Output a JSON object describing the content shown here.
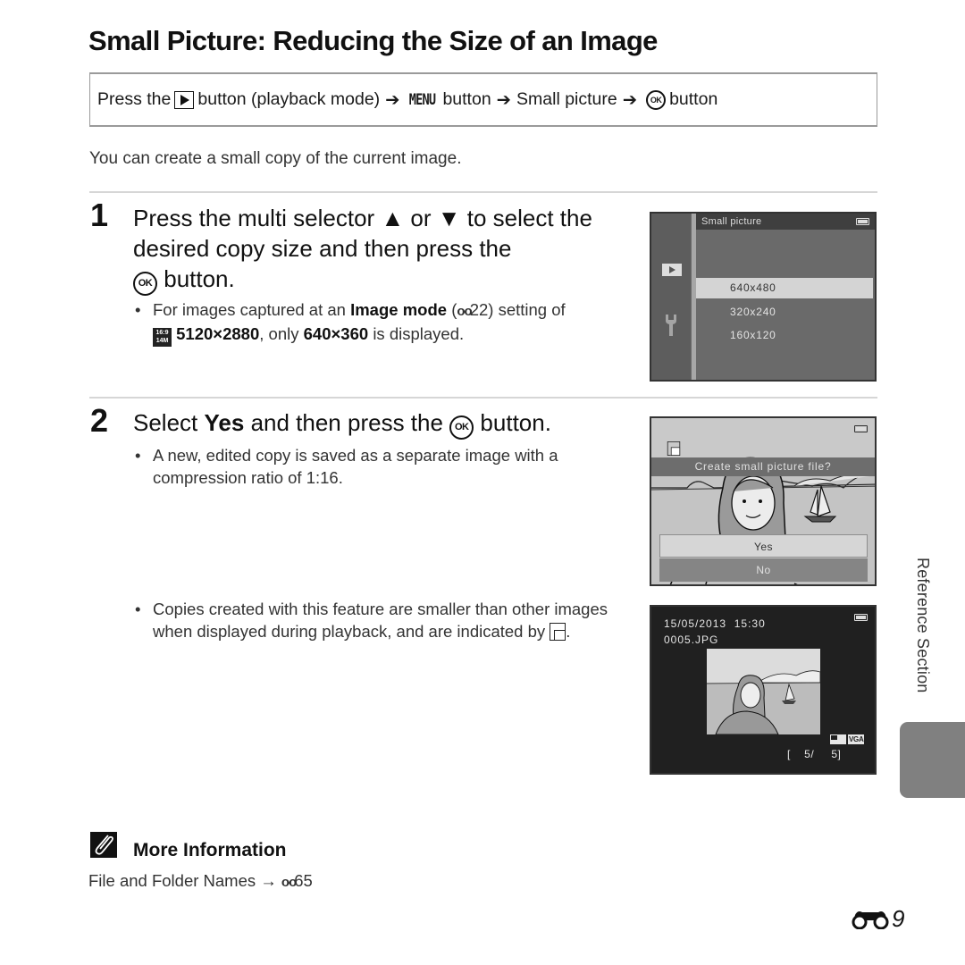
{
  "page": {
    "title": "Small Picture: Reducing the Size of an Image",
    "procedure": {
      "press_the": "Press the",
      "playback_icon": "playback-button-icon",
      "seg1": "button (playback mode)",
      "arrow": "➔",
      "menu": "MENU",
      "seg2": "button",
      "seg3": "Small picture",
      "ok_icon": "OK",
      "seg4": "button"
    },
    "intro": "You can create a small copy of the current image.",
    "step1": {
      "number": "1",
      "line1_a": "Press the multi selector",
      "up": "▲",
      "or": "or",
      "down": "▼",
      "line1_b": "to select the",
      "line2": "desired copy size and then press the",
      "ok": "OK",
      "line3": "button.",
      "bullet_a": "For images captured at an",
      "bullet_bold1": "Image mode",
      "bullet_ref": "(",
      "binoc": "o-o",
      "bullet_ref_num": "22) setting of",
      "mode_icon_top": "16:9",
      "mode_icon_bottom": "14M",
      "bullet_bold2": "5120×2880",
      "bullet_mid": ", only",
      "bullet_bold3": "640×360",
      "bullet_end": "is displayed."
    },
    "step2": {
      "number": "2",
      "head_a": "Select",
      "head_bold": "Yes",
      "head_b": "and then press the",
      "ok": "OK",
      "head_c": "button.",
      "bullet1": "A new, edited copy is saved as a separate image with a compression ratio of 1:16.",
      "bullet2_a": "Copies created with this feature are smaller than other images when displayed during playback, and are indicated by",
      "bullet2_end": "."
    },
    "screen1": {
      "header": "Small picture",
      "options": [
        "640x480",
        "320x240",
        "160x120"
      ],
      "selected_index": 0
    },
    "screen2": {
      "prompt": "Create small picture file?",
      "yes": "Yes",
      "no": "No",
      "selected": "Yes"
    },
    "screen3": {
      "datetime": "15/05/2013  15:30",
      "filename": "0005.JPG",
      "size_badge": "VGA",
      "counter": "[    5/     5]"
    },
    "side": {
      "section_label": "Reference Section"
    },
    "more_info": {
      "title": "More Information",
      "text": "File and Folder Names",
      "arrow": "→",
      "ref": "65"
    },
    "page_number": {
      "prefix_icon": "binoculars-icon",
      "number": "9"
    },
    "colors": {
      "side_tab": "#808080",
      "rule": "#d6d6d6",
      "box_border": "#9a9a9a"
    }
  }
}
